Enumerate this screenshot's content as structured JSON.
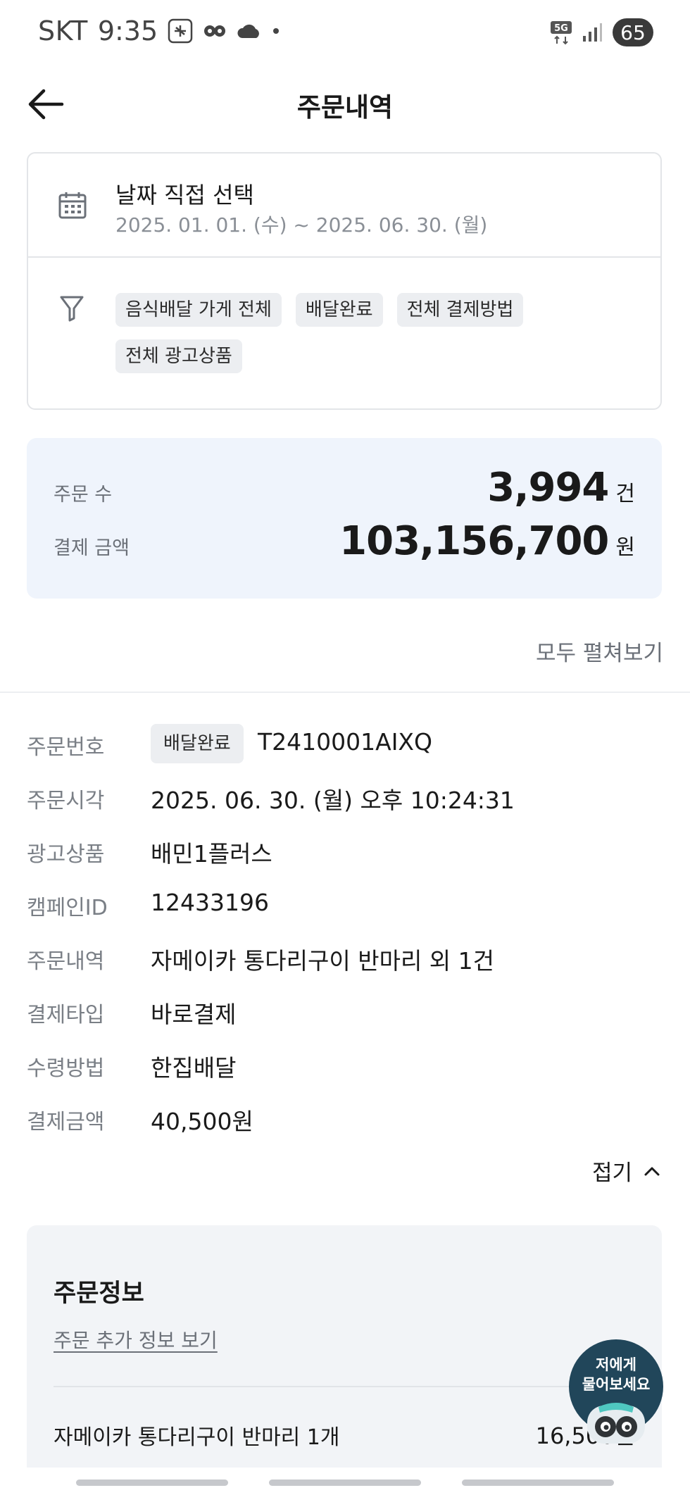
{
  "status_bar": {
    "carrier": "SKT",
    "time": "9:35",
    "network": "5G",
    "battery": "65"
  },
  "header": {
    "title": "주문내역"
  },
  "filters": {
    "date_title": "날짜 직접 선택",
    "date_range": "2025. 01. 01. (수) ~ 2025. 06. 30. (월)",
    "chips": [
      "음식배달 가게 전체",
      "배달완료",
      "전체 결제방법",
      "전체 광고상품"
    ]
  },
  "summary": {
    "order_count_label": "주문 수",
    "order_count": "3,994",
    "order_count_unit": "건",
    "amount_label": "결제 금액",
    "amount": "103,156,700",
    "amount_unit": "원"
  },
  "expand_all_label": "모두 펼쳐보기",
  "order": {
    "status": "배달완료",
    "rows": [
      {
        "label": "주문번호",
        "value": "T2410001AIXQ"
      },
      {
        "label": "주문시각",
        "value": "2025. 06. 30. (월) 오후 10:24:31"
      },
      {
        "label": "광고상품",
        "value": "배민1플러스"
      },
      {
        "label": "캠페인ID",
        "value": "12433196"
      },
      {
        "label": "주문내역",
        "value": "자메이카 통다리구이 반마리 외 1건"
      },
      {
        "label": "결제타입",
        "value": "바로결제"
      },
      {
        "label": "수령방법",
        "value": "한집배달"
      },
      {
        "label": "결제금액",
        "value": "40,500원"
      }
    ],
    "collapse_label": "접기"
  },
  "order_info": {
    "title": "주문정보",
    "more_link": "주문 추가 정보 보기",
    "item_name": "자메이카 통다리구이 반마리 1개",
    "item_price": "16,500원"
  },
  "chatbot": {
    "line1": "저에게",
    "line2": "물어보세요"
  },
  "colors": {
    "summary_bg": "#eff4fc",
    "chip_bg": "#eceef1",
    "chatbot_bg": "#21465a"
  }
}
